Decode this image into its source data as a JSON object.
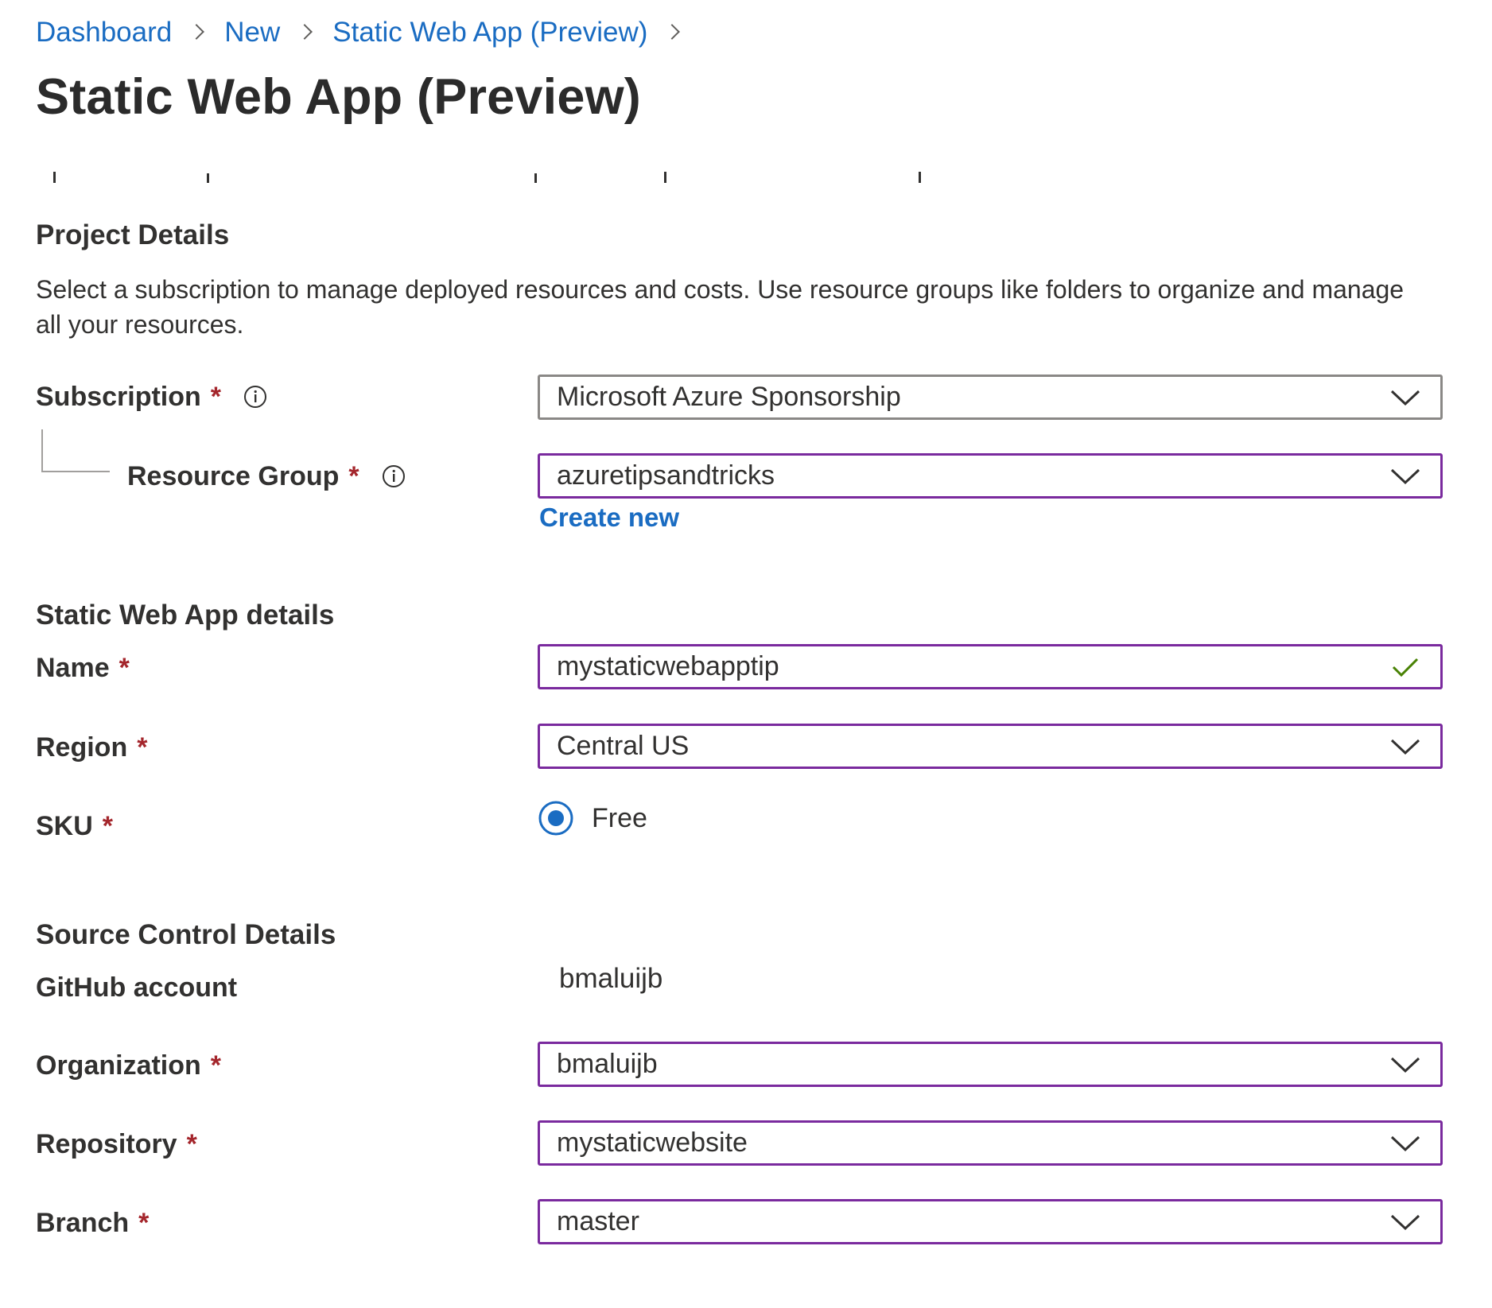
{
  "breadcrumb": {
    "items": [
      "Dashboard",
      "New",
      "Static Web App (Preview)"
    ]
  },
  "page": {
    "title": "Static Web App (Preview)"
  },
  "project_details": {
    "heading": "Project Details",
    "description": "Select a subscription to manage deployed resources and costs. Use resource groups like folders to organize and manage all your resources.",
    "subscription": {
      "label": "Subscription",
      "required_mark": "*",
      "value": "Microsoft Azure Sponsorship"
    },
    "resource_group": {
      "label": "Resource Group",
      "required_mark": "*",
      "value": "azuretipsandtricks",
      "create_new_label": "Create new"
    }
  },
  "app_details": {
    "heading": "Static Web App details",
    "name": {
      "label": "Name",
      "required_mark": "*",
      "value": "mystaticwebapptip"
    },
    "region": {
      "label": "Region",
      "required_mark": "*",
      "value": "Central US"
    },
    "sku": {
      "label": "SKU",
      "required_mark": "*",
      "option_label": "Free",
      "selected": true
    }
  },
  "source_control": {
    "heading": "Source Control Details",
    "github_account": {
      "label": "GitHub account",
      "value": "bmaluijb"
    },
    "organization": {
      "label": "Organization",
      "required_mark": "*",
      "value": "bmaluijb"
    },
    "repository": {
      "label": "Repository",
      "required_mark": "*",
      "value": "mystaticwebsite"
    },
    "branch": {
      "label": "Branch",
      "required_mark": "*",
      "value": "master"
    }
  },
  "icons": {
    "info": "info-icon",
    "chevron": "chevron-down-icon",
    "valid": "checkmark-icon",
    "separator": "chevron-right-icon"
  },
  "colors": {
    "link": "#1a6cc2",
    "focus_border": "#7a2a9e",
    "required": "#a4262c",
    "valid_check": "#498205",
    "radio_selected": "#1a6cc2"
  }
}
